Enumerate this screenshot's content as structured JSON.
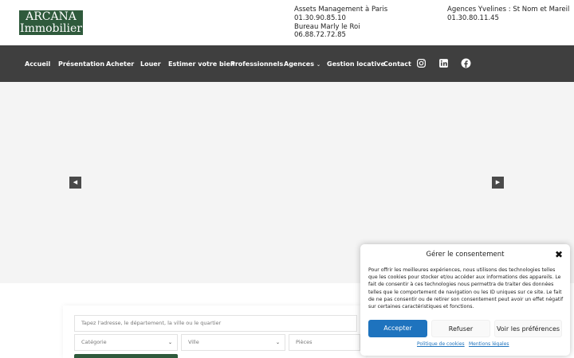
{
  "brand": {
    "line1": "ARCANA",
    "line2": "Immobilier",
    "color": "#2f5a3c"
  },
  "contacts": {
    "col1": [
      "Assets Management à Paris",
      "01.30.90.85.10",
      "Bureau Marly le Roi",
      "06.88.72.72.85"
    ],
    "col2": [
      "Agences Yvelines : St Nom et Mareil",
      "01.30.80.11.45"
    ]
  },
  "nav": {
    "items": [
      "Accueil",
      "Présentation",
      "Acheter",
      "Louer",
      "Estimer votre bien",
      "Professionnels",
      "Agences",
      "Gestion locative",
      "Contact"
    ],
    "agences_caret": "⌄",
    "social": [
      "instagram-icon",
      "linkedin-icon",
      "facebook-icon"
    ],
    "background": "#3f3f3f"
  },
  "slider": {
    "prev": "◀",
    "next": "▶"
  },
  "search": {
    "address_placeholder": "Tapez l'adresse, le département, la ville ou le quartier",
    "category": "Catégorie",
    "city": "Ville",
    "rooms": "Pièces",
    "chevron": "⌄"
  },
  "consent": {
    "title": "Gérer le consentement",
    "close": "✖",
    "body": "Pour offrir les meilleures expériences, nous utilisons des technologies telles que les cookies pour stocker et/ou accéder aux informations des appareils. Le fait de consentir à ces technologies nous permettra de traiter des données telles que le comportement de navigation ou les ID uniques sur ce site. Le fait de ne pas consentir ou de retirer son consentement peut avoir un effet négatif sur certaines caractéristiques et fonctions.",
    "accept": "Accepter",
    "refuse": "Refuser",
    "preferences": "Voir les préférences",
    "cookie_policy": "Politique de cookies",
    "legal": "Mentions légales",
    "accent": "#1e73be"
  }
}
